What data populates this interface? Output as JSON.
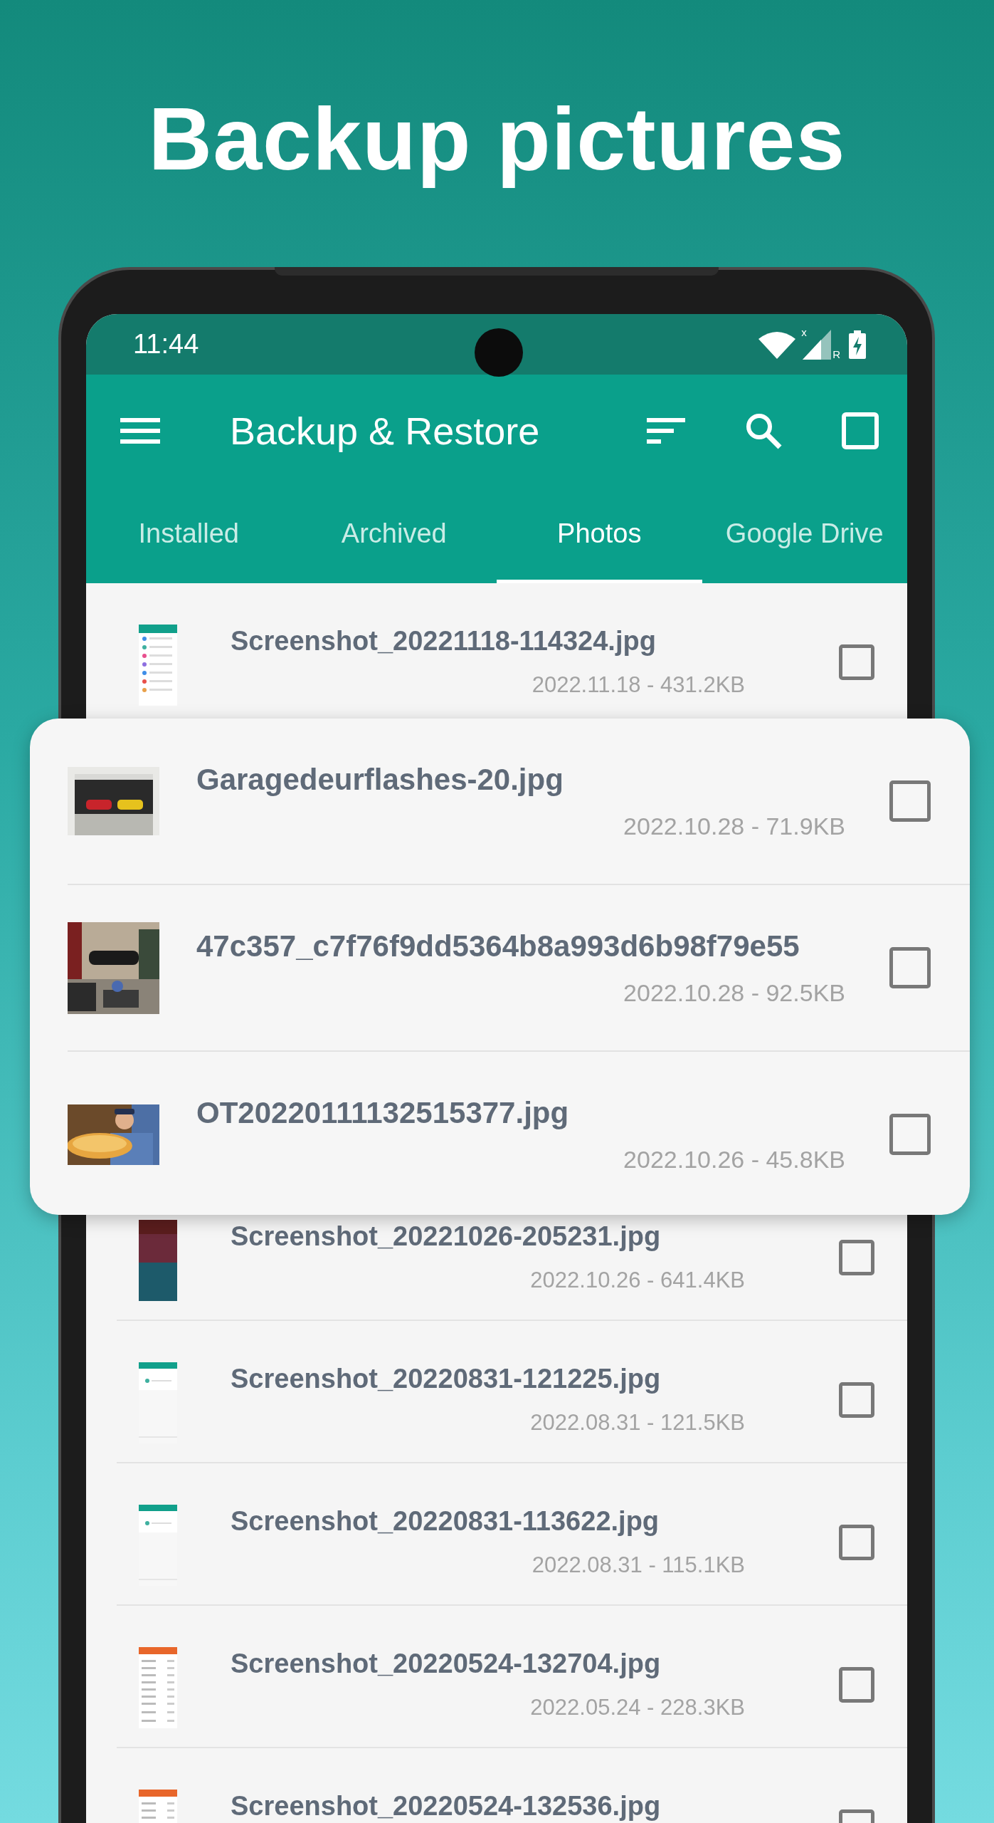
{
  "headline": "Backup pictures",
  "status_bar": {
    "time": "11:44",
    "data_mark": "x",
    "roaming_mark": "R"
  },
  "app_bar": {
    "title": "Backup & Restore"
  },
  "tabs": [
    {
      "label": "Installed",
      "selected": false
    },
    {
      "label": "Archived",
      "selected": false
    },
    {
      "label": "Photos",
      "selected": true
    },
    {
      "label": "Google Drive",
      "selected": false
    }
  ],
  "photo_list": [
    {
      "thumbnail": {
        "kind": "list"
      },
      "name": "Screenshot_20221118-114324.jpg",
      "info": "2022.11.18 - 431.2KB",
      "checked": false
    },
    {
      "thumbnail": {
        "kind": "lockscreen"
      },
      "name": "Screenshot_20221026-205231.jpg",
      "info": "2022.10.26 - 641.4KB",
      "checked": false
    },
    {
      "thumbnail": {
        "kind": "dialog"
      },
      "name": "Screenshot_20220831-121225.jpg",
      "info": "2022.08.31 - 121.5KB",
      "checked": false
    },
    {
      "thumbnail": {
        "kind": "dialog"
      },
      "name": "Screenshot_20220831-113622.jpg",
      "info": "2022.08.31 - 115.1KB",
      "checked": false
    },
    {
      "thumbnail": {
        "kind": "form"
      },
      "name": "Screenshot_20220524-132704.jpg",
      "info": "2022.05.24 - 228.3KB",
      "checked": false
    },
    {
      "thumbnail": {
        "kind": "form"
      },
      "name": "Screenshot_20220524-132536.jpg",
      "checked": false
    }
  ],
  "popup_card": {
    "rows": [
      {
        "name": "Garagedeurflashes-20.jpg",
        "info": "2022.10.28 - 71.9KB",
        "checked": false
      },
      {
        "name": "47c357_c7f76f9dd5364b8a993d6b98f79e55",
        "info": "2022.10.28 - 92.5KB",
        "checked": false
      },
      {
        "name": "OT20220111132515377.jpg",
        "info": "2022.10.26 - 45.8KB",
        "checked": false
      }
    ]
  }
}
